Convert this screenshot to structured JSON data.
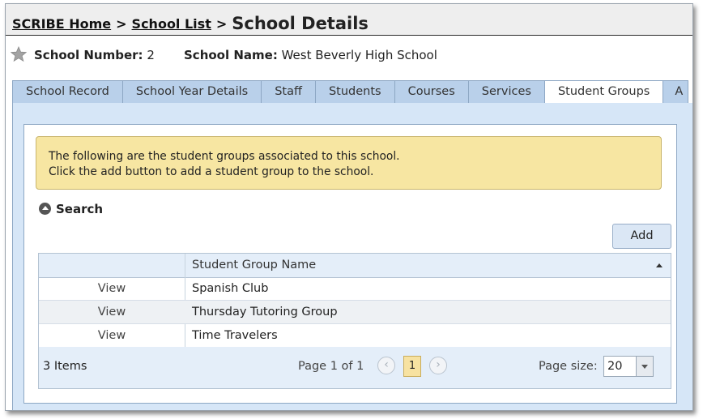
{
  "breadcrumb": {
    "home": "SCRIBE Home",
    "list": "School List",
    "separator": ">",
    "current": "School Details"
  },
  "school": {
    "number_label": "School Number:",
    "number": "2",
    "name_label": "School Name:",
    "name": "West Beverly High School"
  },
  "tabs": [
    {
      "label": "School Record"
    },
    {
      "label": "School Year Details"
    },
    {
      "label": "Staff"
    },
    {
      "label": "Students"
    },
    {
      "label": "Courses"
    },
    {
      "label": "Services"
    },
    {
      "label": "Student Groups",
      "active": true
    },
    {
      "label": "A"
    }
  ],
  "notice": {
    "line1": "The following are the student groups associated to this school.",
    "line2": "Click the add button to add a student group to the school."
  },
  "search": {
    "label": "Search",
    "icon": "collapse-up-icon"
  },
  "add_button": "Add",
  "grid": {
    "column_header": "Student Group Name",
    "rows": [
      {
        "action": "View",
        "name": "Spanish Club"
      },
      {
        "action": "View",
        "name": "Thursday Tutoring Group"
      },
      {
        "action": "View",
        "name": "Time Travelers"
      }
    ]
  },
  "pager": {
    "items": "3 Items",
    "page_info": "Page 1 of 1",
    "current_page": "1",
    "prev_icon": "‹",
    "next_icon": "›",
    "page_size_label": "Page size:",
    "page_size": "20"
  },
  "colors": {
    "tab_bg": "#b9d0ea",
    "panel_bg": "#d6e6f7",
    "notice_bg": "#f7e6a2",
    "active_page": "#f7e2a1"
  }
}
